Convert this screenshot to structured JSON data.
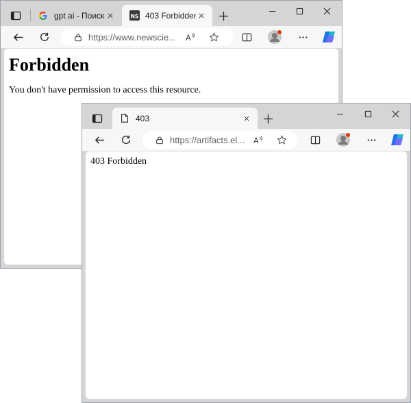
{
  "window_back": {
    "tabs": [
      {
        "title": "gpt ai - Поиск в",
        "favicon": "google-favicon-icon"
      },
      {
        "title": "403 Forbidden",
        "favicon": "newscientist-favicon-icon"
      }
    ],
    "url": "https://www.newscie...",
    "page": {
      "heading": "Forbidden",
      "text": "You don't have permission to access this resource."
    }
  },
  "window_front": {
    "tabs": [
      {
        "title": "403",
        "favicon": "page-icon"
      }
    ],
    "url": "https://artifacts.el...",
    "page": {
      "text": "403 Forbidden"
    }
  },
  "colors": {
    "titlebar": "#d5d5d5",
    "toolbar": "#f7f7f7",
    "copilot_blue": "#1a73e8",
    "profile_badge": "#d83b01"
  }
}
